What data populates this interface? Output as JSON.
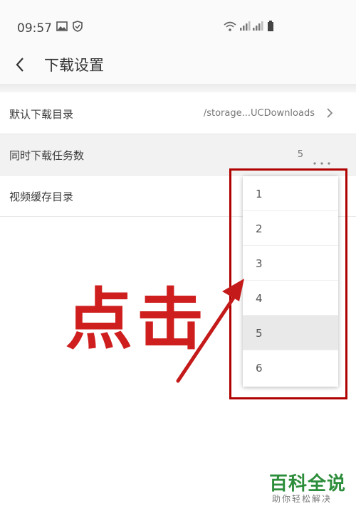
{
  "status_bar": {
    "time": "09:57"
  },
  "header": {
    "title": "下载设置"
  },
  "settings": [
    {
      "label": "默认下载目录",
      "value": "/storage...UCDownloads"
    },
    {
      "label": "同时下载任务数",
      "value": "5"
    },
    {
      "label": "视频缓存目录",
      "value": ""
    }
  ],
  "dropdown": {
    "options": [
      "1",
      "2",
      "3",
      "4",
      "5",
      "6"
    ],
    "selected": "5"
  },
  "annotation": {
    "text": "点击",
    "color": "#cf1e1e"
  },
  "watermark": {
    "title": "百科全说",
    "subtitle": "助你轻松解决"
  }
}
